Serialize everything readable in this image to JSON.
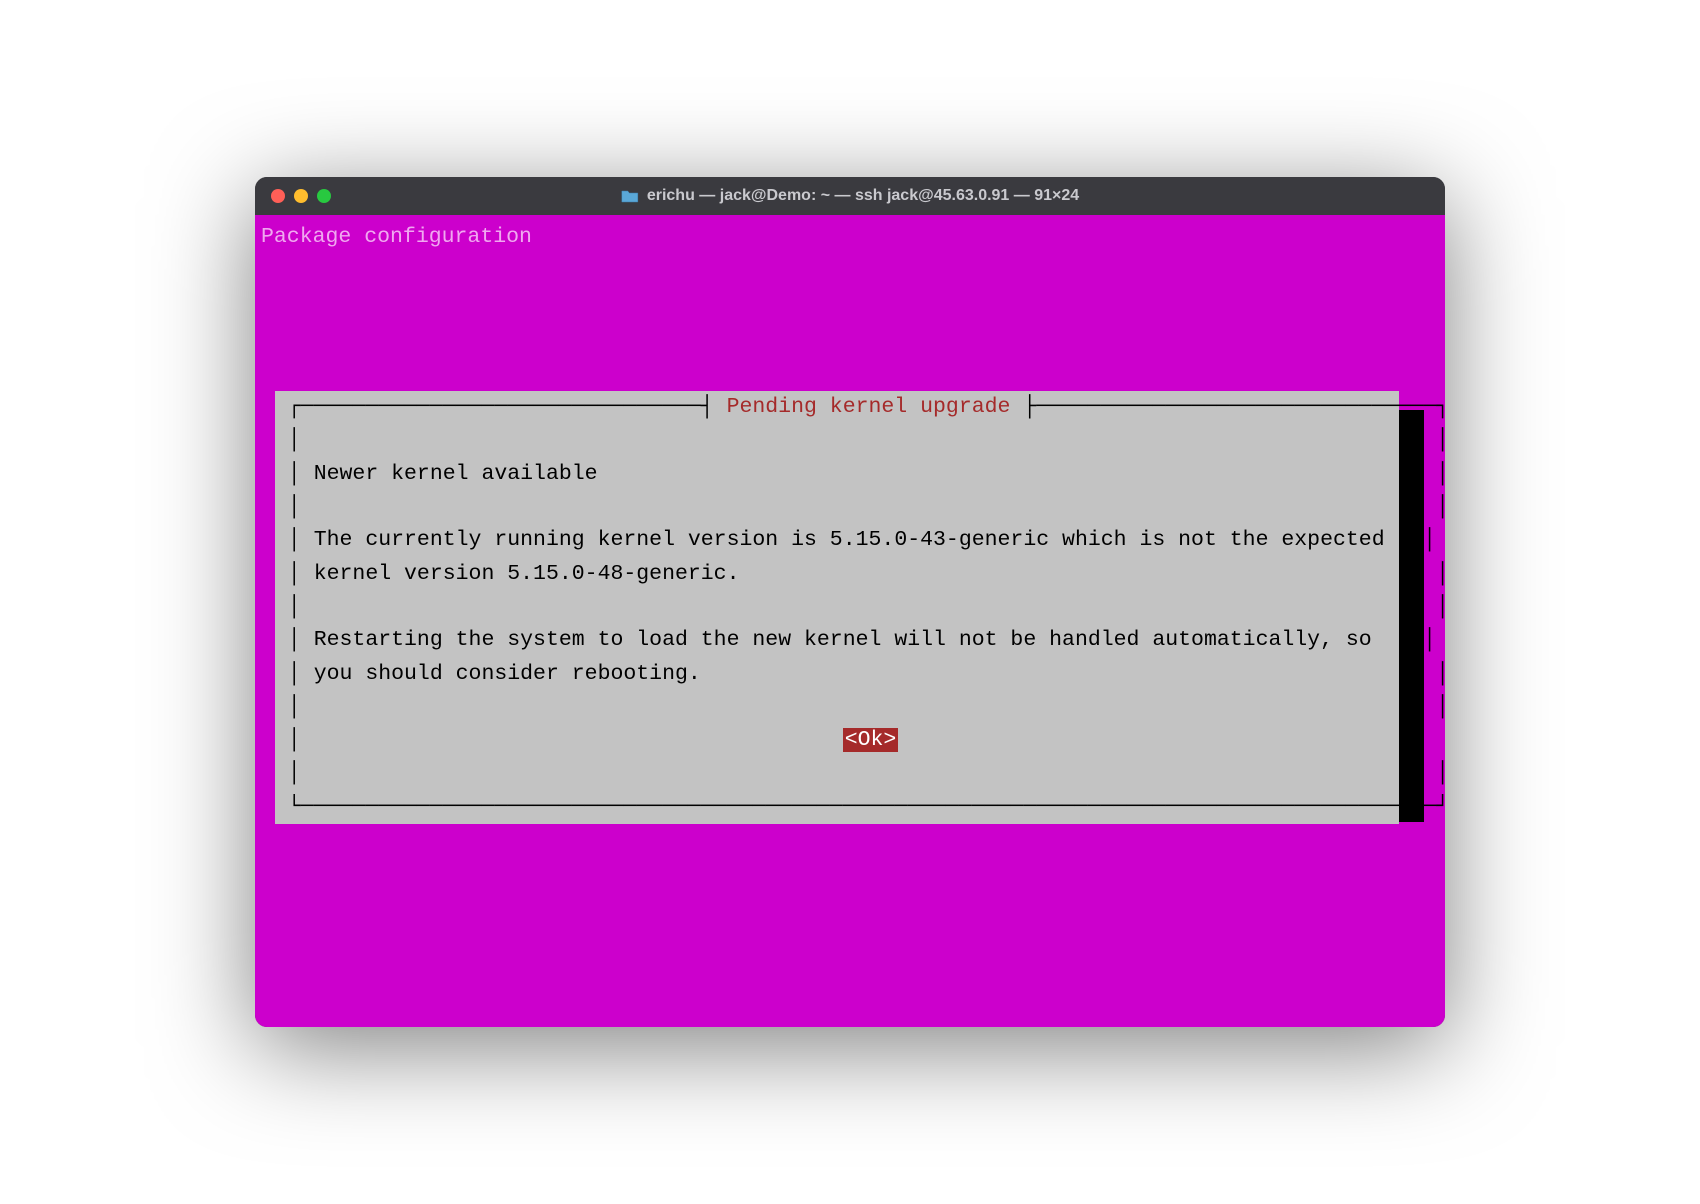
{
  "window": {
    "title": "erichu — jack@Demo: ~ — ssh jack@45.63.0.91 — 91×24"
  },
  "terminal": {
    "header": "Package configuration"
  },
  "dialog": {
    "title": "Pending kernel upgrade",
    "subtitle": "Newer kernel available",
    "body_line1": "The currently running kernel version is 5.15.0-43-generic which is not the expected",
    "body_line2": "kernel version 5.15.0-48-generic.",
    "body_line3": "Restarting the system to load the new kernel will not be handled automatically, so",
    "body_line4": "you should consider rebooting.",
    "ok_label": "<Ok>"
  },
  "colors": {
    "terminal_bg": "#cc00cc",
    "dialog_bg": "#c3c3c3",
    "dialog_title": "#a52a2a",
    "ok_bg": "#a52a2a"
  }
}
